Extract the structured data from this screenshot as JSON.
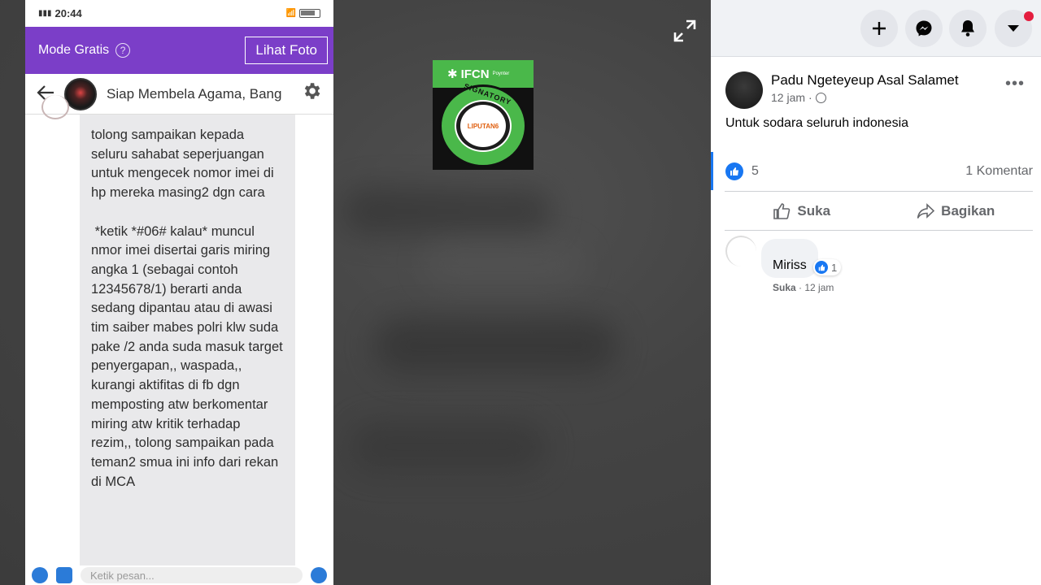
{
  "phone": {
    "status_time": "20:44",
    "banner_label": "Mode Gratis",
    "help_glyph": "?",
    "view_photo_label": "Lihat Foto",
    "chat_title": "Siap Membela Agama, Bang",
    "message": "tolong sampaikan kepada seluru sahabat seperjuangan untuk mengecek nomor imei di hp mereka masing2 dgn cara\n\n *ketik *#06# kalau* muncul nmor imei disertai garis miring angka 1 (sebagai contoh 12345678/1) berarti anda sedang dipantau atau di awasi tim saiber mabes polri klw suda pake /2 anda suda masuk target penyergapan,, waspada,, kurangi aktifitas di fb dgn memposting atw berkomentar miring atw kritik terhadap rezim,, tolong sampaikan pada teman2 smua ini info dari rekan di MCA",
    "composer_placeholder": "Ketik pesan..."
  },
  "badge": {
    "title": "IFCN",
    "subtitle": "Poynter",
    "ring_text": "SIGNATORY",
    "center_text": "LIPUTAN6"
  },
  "post": {
    "author": "Padu Ngeteyeup Asal Salamet",
    "time": "12 jam",
    "time_sep": "·",
    "text": "Untuk sodara seluruh indonesia",
    "like_count": "5",
    "comment_count": "1 Komentar",
    "like_label": "Suka",
    "share_label": "Bagikan",
    "more": "•••"
  },
  "comment": {
    "text": "Miriss",
    "react_count": "1",
    "like_label": "Suka",
    "sep": "·",
    "time": "12 jam"
  },
  "colors": {
    "accent": "#1877f2",
    "banner": "#7b3ec8",
    "badge_green": "#4ab84a",
    "notification": "#e41e3f"
  },
  "icons": {
    "topbar": [
      "plus-icon",
      "messenger-icon",
      "bell-icon",
      "caret-down-icon"
    ],
    "fullscreen": "expand-icon"
  }
}
